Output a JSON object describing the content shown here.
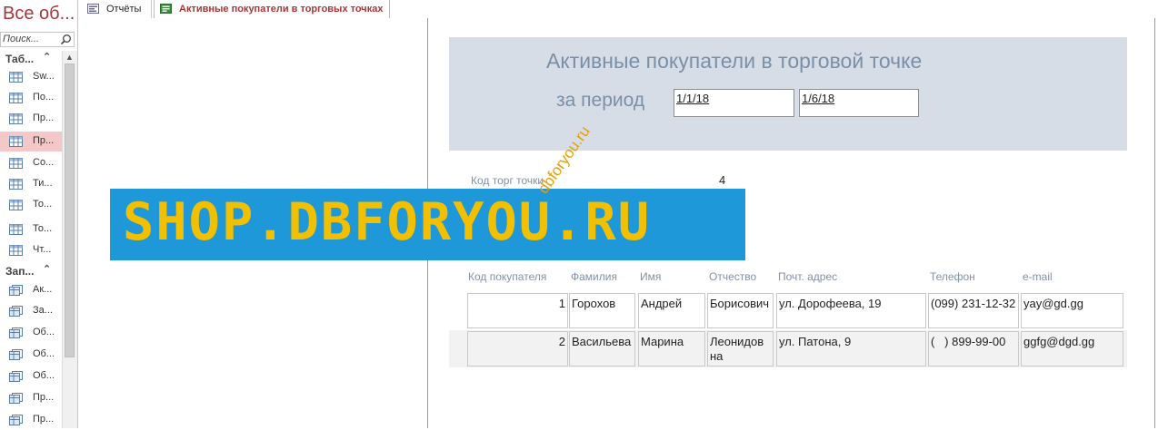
{
  "nav": {
    "title": "Все об...",
    "search_placeholder": "Поиск...",
    "groups": [
      {
        "label": "Таб..."
      },
      {
        "label": "Зап..."
      }
    ],
    "tables": [
      "Sw...",
      "По...",
      "Пр...",
      "Пр...",
      "Со...",
      "Ти...",
      "То...",
      "То...",
      "Чт..."
    ],
    "queries": [
      "Ак...",
      "За...",
      "Об...",
      "Об...",
      "Об...",
      "Пр...",
      "Пр..."
    ]
  },
  "tabs": [
    {
      "label": "Отчёты"
    },
    {
      "label": "Активные покупатели в торговых точках"
    }
  ],
  "report": {
    "title": "Активные покупатели в торговой точке",
    "period_label": "за период",
    "date_from": "1/1/18",
    "date_to": "1/6/18",
    "shop_label": "Код торг точки",
    "shop_value": "4",
    "columns": [
      "Код покупателя",
      "Фамилия",
      "Имя",
      "Отчество",
      "Почт. адрес",
      "Телефон",
      "e-mail"
    ],
    "rows": [
      {
        "id": "1",
        "last": "Горохов",
        "first": "Андрей",
        "middle": "Борисович",
        "address": "ул. Дорофеева, 19",
        "phone": "(099) 231-12-32",
        "email": "yay@gd.gg"
      },
      {
        "id": "2",
        "last": "Васильева",
        "first": "Марина",
        "middle": "Леонидов на",
        "address": "ул. Патона, 9",
        "phone": "(   ) 899-99-00",
        "email": "ggfg@dgd.gg"
      }
    ]
  },
  "watermark": {
    "text": "SHOP.DBFORYOU.RU",
    "diagonal": "dbforyou.ru"
  }
}
